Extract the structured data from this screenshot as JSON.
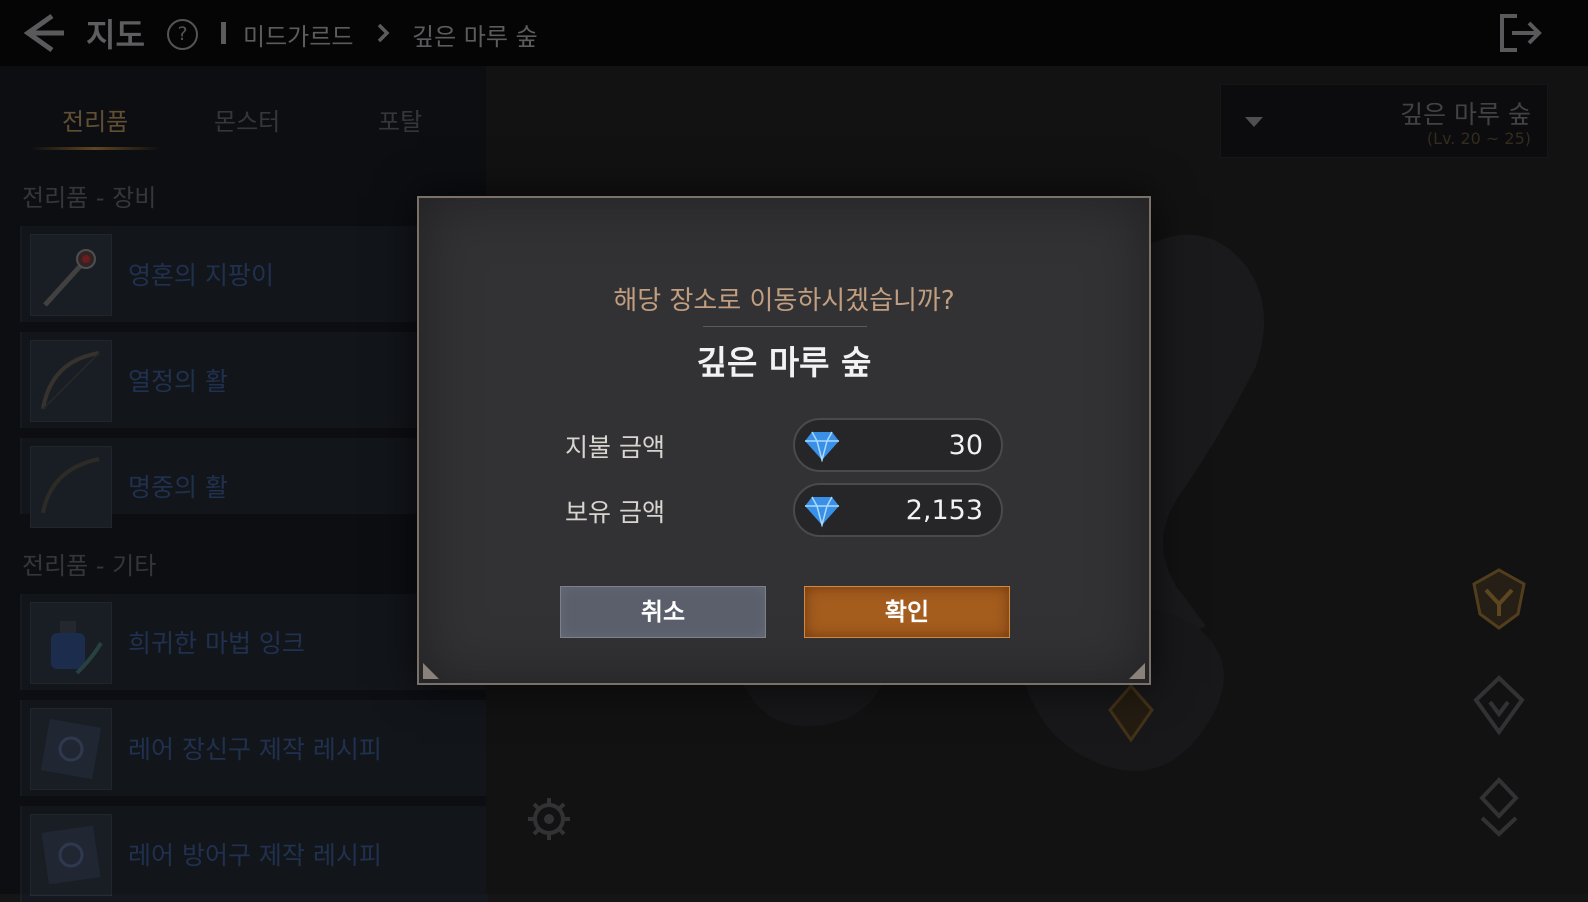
{
  "header": {
    "title": "지도",
    "breadcrumb": [
      "미드가르드",
      "깊은 마루 숲"
    ],
    "icons": [
      "back-arrow-icon",
      "help-icon",
      "chevron-right-icon",
      "exit-icon"
    ]
  },
  "tabs": [
    {
      "label": "전리품",
      "active": true
    },
    {
      "label": "몬스터",
      "active": false
    },
    {
      "label": "포탈",
      "active": false
    }
  ],
  "loot": {
    "equipment_title": "전리품 - 장비",
    "equipment": [
      {
        "name": "영혼의 지팡이",
        "icon": "staff-icon"
      },
      {
        "name": "열정의 활",
        "icon": "bow-icon"
      },
      {
        "name": "명중의 활",
        "icon": "bow-icon"
      }
    ],
    "other_title": "전리품 - 기타",
    "other": [
      {
        "name": "희귀한 마법 잉크",
        "icon": "ink-bottle-icon"
      },
      {
        "name": "레어 장신구 제작 레시피",
        "icon": "recipe-icon"
      },
      {
        "name": "레어 방어구 제작 레시피",
        "icon": "recipe-icon"
      }
    ]
  },
  "region": {
    "name": "깊은 마루 숲",
    "level": "(Lv. 20 ~ 25)"
  },
  "dialog": {
    "question": "해당 장소로 이동하시겠습니까?",
    "destination": "깊은 마루 숲",
    "pay_label": "지불 금액",
    "pay_amount": "30",
    "owned_label": "보유 금액",
    "owned_amount": "2,153",
    "currency_icon": "diamond-icon",
    "cancel_label": "취소",
    "confirm_label": "확인"
  },
  "colors": {
    "dialog_bg": "#323235",
    "question_text": "#c19e80",
    "confirm_button": "#a55d1e",
    "cancel_button": "#5a5f6b",
    "gem_blue": "#3a8fe6"
  }
}
